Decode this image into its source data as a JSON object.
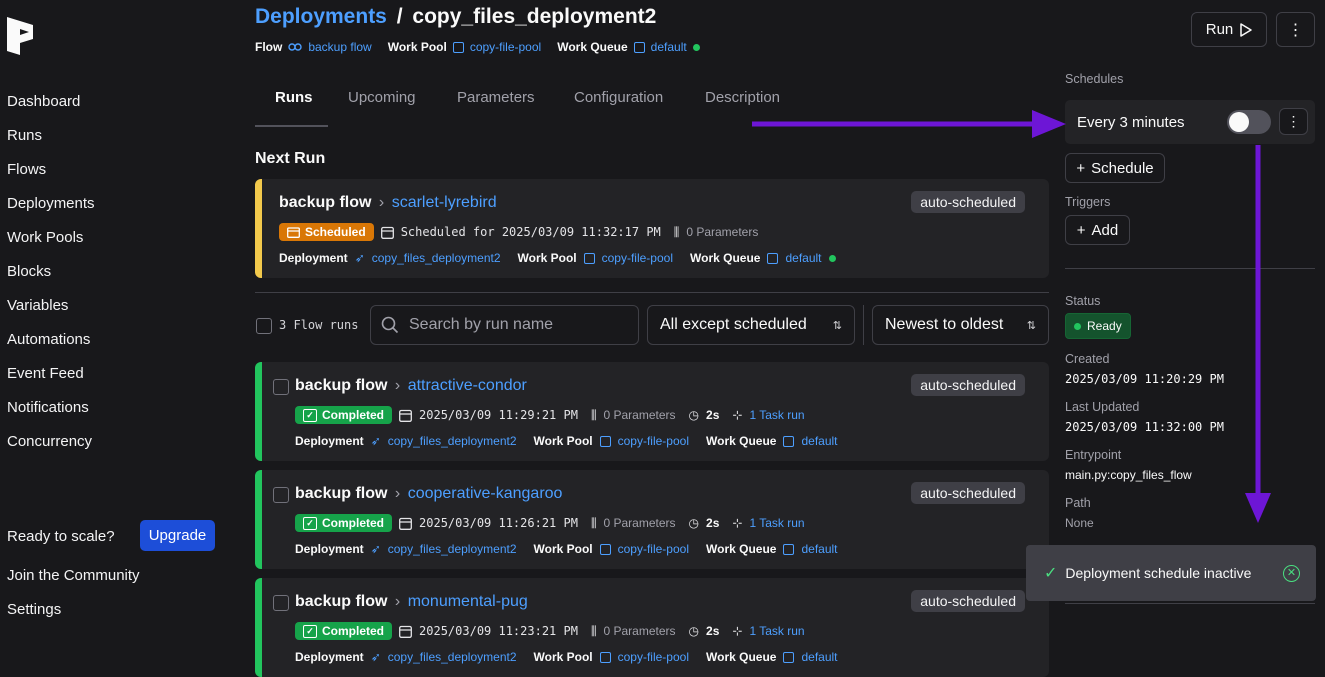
{
  "nav": {
    "items": [
      "Dashboard",
      "Runs",
      "Flows",
      "Deployments",
      "Work Pools",
      "Blocks",
      "Variables",
      "Automations",
      "Event Feed",
      "Notifications",
      "Concurrency"
    ],
    "ready_text": "Ready to scale?",
    "upgrade": "Upgrade",
    "community": "Join the Community",
    "settings": "Settings"
  },
  "header": {
    "crumb_root": "Deployments",
    "crumb_sep": "/",
    "crumb_current": "copy_files_deployment2",
    "flow_label": "Flow",
    "flow_value": "backup flow",
    "pool_label": "Work Pool",
    "pool_value": "copy-file-pool",
    "queue_label": "Work Queue",
    "queue_value": "default",
    "run_button": "Run"
  },
  "tabs": [
    "Runs",
    "Upcoming",
    "Parameters",
    "Configuration",
    "Description"
  ],
  "next_run": {
    "heading": "Next Run",
    "flow": "backup flow",
    "run_name": "scarlet-lyrebird",
    "badge": "auto-scheduled",
    "state": "Scheduled",
    "scheduled_text": "Scheduled for 2025/03/09 11:32:17 PM",
    "params": "0 Parameters",
    "deployment_label": "Deployment",
    "deployment_value": "copy_files_deployment2",
    "pool_label": "Work Pool",
    "pool_value": "copy-file-pool",
    "queue_label": "Work Queue",
    "queue_value": "default"
  },
  "filters": {
    "count": "3 Flow runs",
    "search_placeholder": "Search by run name",
    "state_filter": "All except scheduled",
    "sort": "Newest to oldest"
  },
  "runs": [
    {
      "flow": "backup flow",
      "name": "attractive-condor",
      "badge": "auto-scheduled",
      "state": "Completed",
      "time": "2025/03/09 11:29:21 PM",
      "params": "0 Parameters",
      "duration": "2s",
      "tasks": "1 Task run",
      "deployment": "copy_files_deployment2",
      "pool": "copy-file-pool",
      "queue": "default"
    },
    {
      "flow": "backup flow",
      "name": "cooperative-kangaroo",
      "badge": "auto-scheduled",
      "state": "Completed",
      "time": "2025/03/09 11:26:21 PM",
      "params": "0 Parameters",
      "duration": "2s",
      "tasks": "1 Task run",
      "deployment": "copy_files_deployment2",
      "pool": "copy-file-pool",
      "queue": "default"
    },
    {
      "flow": "backup flow",
      "name": "monumental-pug",
      "badge": "auto-scheduled",
      "state": "Completed",
      "time": "2025/03/09 11:23:21 PM",
      "params": "0 Parameters",
      "duration": "2s",
      "tasks": "1 Task run",
      "deployment": "copy_files_deployment2",
      "pool": "copy-file-pool",
      "queue": "default"
    }
  ],
  "labels": {
    "deployment": "Deployment",
    "pool": "Work Pool",
    "queue": "Work Queue"
  },
  "panel": {
    "schedules_label": "Schedules",
    "schedule_text": "Every 3 minutes",
    "schedule_active": false,
    "add_schedule": "Schedule",
    "triggers_label": "Triggers",
    "add_trigger": "Add",
    "status_label": "Status",
    "status_value": "Ready",
    "created_label": "Created",
    "created_value": "2025/03/09 11:20:29 PM",
    "updated_label": "Last Updated",
    "updated_value": "2025/03/09 11:32:00 PM",
    "entry_label": "Entrypoint",
    "entry_value": "main.py:copy_files_flow",
    "path_label": "Path",
    "path_value": "None"
  },
  "toast": {
    "message": "Deployment schedule inactive"
  },
  "colors": {
    "accent_link": "#4d9fff",
    "completed": "#16a34a",
    "scheduled": "#d97706",
    "annotation_arrow": "#6d16d6"
  }
}
